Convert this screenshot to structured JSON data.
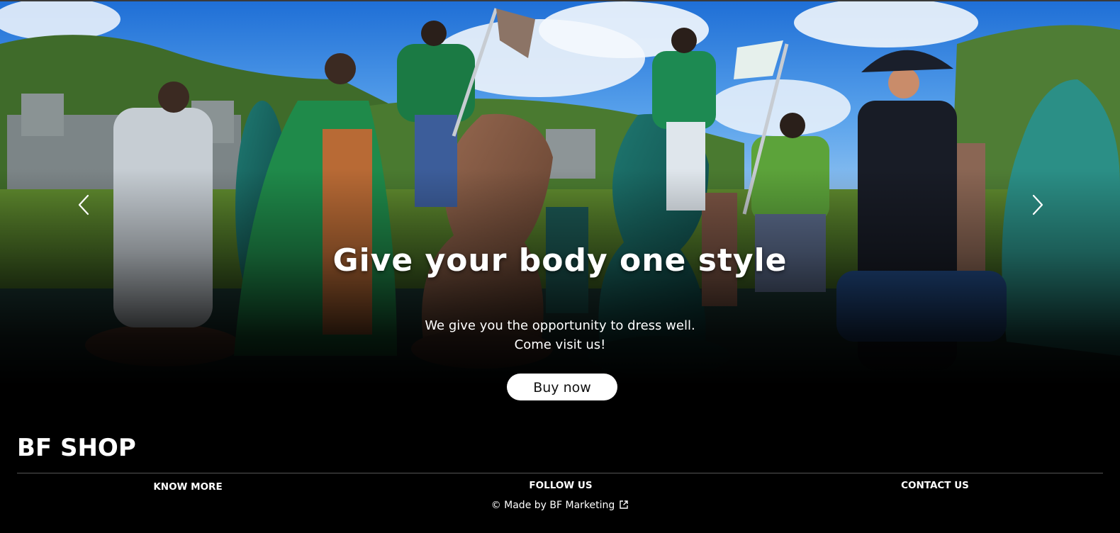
{
  "hero": {
    "title": "Give your body one style",
    "subtitle_lines": [
      "We give you the opportunity to dress well.",
      "Come visit us!"
    ],
    "cta_label": "Buy now"
  },
  "footer": {
    "brand": "BF SHOP",
    "links": [
      "KNOW MORE",
      "FOLLOW US",
      "CONTACT US"
    ],
    "credit_prefix": "© Made by ",
    "credit_link": "BF Marketing"
  },
  "icons": {
    "prev": "chevron-left-icon",
    "next": "chevron-right-icon",
    "external": "external-link-icon"
  },
  "colors": {
    "background": "#000000",
    "button_bg": "#ffffff",
    "button_text": "#111111",
    "text": "#ffffff"
  }
}
